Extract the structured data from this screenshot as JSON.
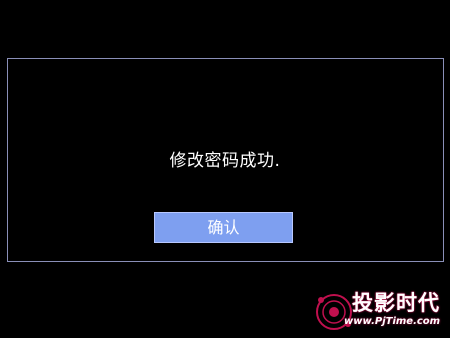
{
  "dialog": {
    "message": "修改密码成功.",
    "ok_label": "确认"
  },
  "watermark": {
    "title": "投影时代",
    "url": "www.PjTime.com"
  },
  "colors": {
    "background": "#000000",
    "frame_border": "#8a8fb8",
    "button_fill": "#7e9ff0",
    "text": "#ffffff",
    "watermark_accent": "#c0104e"
  }
}
